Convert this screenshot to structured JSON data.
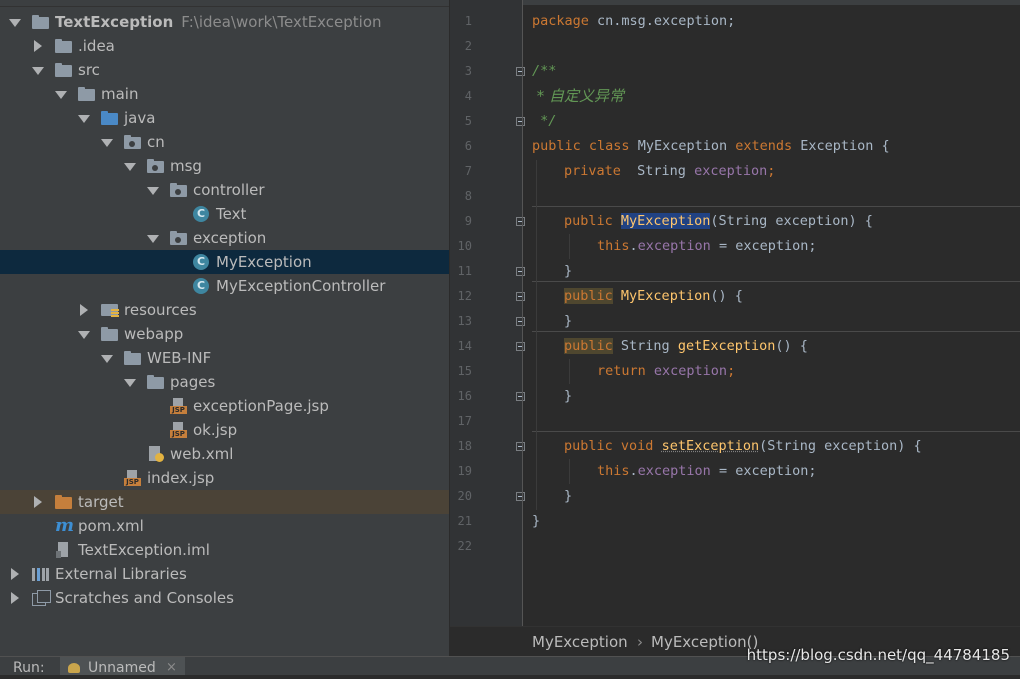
{
  "project_tree": {
    "root": {
      "name": "TextException",
      "path": "F:\\idea\\work\\TextException"
    },
    "items": [
      {
        "label": "TextException",
        "icon": "module-folder-icon"
      },
      {
        "label": ".idea",
        "icon": "folder-icon"
      },
      {
        "label": "src",
        "icon": "folder-icon"
      },
      {
        "label": "main",
        "icon": "folder-icon"
      },
      {
        "label": "java",
        "icon": "source-folder-icon"
      },
      {
        "label": "cn",
        "icon": "package-icon"
      },
      {
        "label": "msg",
        "icon": "package-icon"
      },
      {
        "label": "controller",
        "icon": "package-icon"
      },
      {
        "label": "Text",
        "icon": "class-icon"
      },
      {
        "label": "exception",
        "icon": "package-icon"
      },
      {
        "label": "MyException",
        "icon": "class-icon"
      },
      {
        "label": "MyExceptionController",
        "icon": "class-icon"
      },
      {
        "label": "resources",
        "icon": "resources-folder-icon"
      },
      {
        "label": "webapp",
        "icon": "folder-icon"
      },
      {
        "label": "WEB-INF",
        "icon": "folder-icon"
      },
      {
        "label": "pages",
        "icon": "folder-icon"
      },
      {
        "label": "exceptionPage.jsp",
        "icon": "jsp-file-icon"
      },
      {
        "label": "ok.jsp",
        "icon": "jsp-file-icon"
      },
      {
        "label": "web.xml",
        "icon": "xml-file-icon"
      },
      {
        "label": "index.jsp",
        "icon": "jsp-file-icon"
      },
      {
        "label": "target",
        "icon": "excluded-folder-icon"
      },
      {
        "label": "pom.xml",
        "icon": "maven-icon"
      },
      {
        "label": "TextException.iml",
        "icon": "iml-file-icon"
      },
      {
        "label": "External Libraries",
        "icon": "libraries-icon"
      },
      {
        "label": "Scratches and Consoles",
        "icon": "scratches-icon"
      }
    ]
  },
  "editor": {
    "line_numbers": [
      "1",
      "2",
      "3",
      "4",
      "5",
      "6",
      "7",
      "8",
      "9",
      "10",
      "11",
      "12",
      "13",
      "14",
      "15",
      "16",
      "17",
      "18",
      "19",
      "20",
      "21",
      "22"
    ],
    "code": {
      "l1": {
        "kw": "package",
        "rest": " cn.msg.exception;"
      },
      "l3": "/**",
      "l4": " * 自定义异常",
      "l5": " */",
      "l6": {
        "kw1": "public",
        "kw2": "class",
        "name": " MyException ",
        "kw3": "extends",
        "rest": " Exception {"
      },
      "l7": {
        "kw": "private",
        "type": "  String ",
        "field": "exception",
        "end": ";"
      },
      "l9": {
        "kw": "public",
        "name": "MyException",
        "rest": "(String exception) {"
      },
      "l10": {
        "kw": "this",
        "dot": ".",
        "field": "exception",
        "rest": " = exception;"
      },
      "l11": "}",
      "l12": {
        "kw": "public",
        "name": "MyException",
        "rest": "() {"
      },
      "l13": "}",
      "l14": {
        "kw": "public",
        "type": " String ",
        "method": "getException",
        "rest": "() {"
      },
      "l15": {
        "kw": "return",
        "field": " exception",
        "end": ";"
      },
      "l16": "}",
      "l18": {
        "kw1": "public",
        "kw2": " void ",
        "method": "setException",
        "rest": "(String exception) {"
      },
      "l19": {
        "kw": "this",
        "dot": ".",
        "field": "exception",
        "rest": " = exception;"
      },
      "l20": "}",
      "l21": "}"
    }
  },
  "breadcrumb": {
    "class": "MyException",
    "separator": "›",
    "method": "MyException()"
  },
  "run_bar": {
    "label": "Run:",
    "tab": "Unnamed",
    "close": "×"
  },
  "watermark": "https://blog.csdn.net/qq_44784185"
}
